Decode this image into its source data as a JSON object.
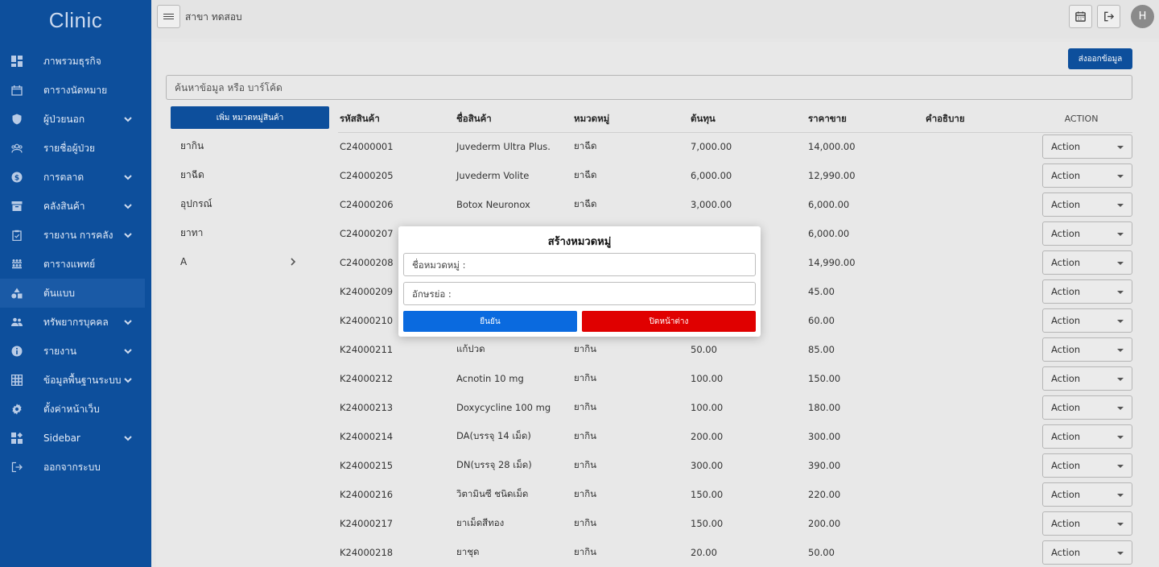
{
  "app": {
    "brand": "Clinic"
  },
  "sidebar": {
    "items": [
      {
        "label": "ภาพรวมธุรกิจ",
        "icon": "dashboard-icon",
        "has_submenu": false
      },
      {
        "label": "ตารางนัดหมาย",
        "icon": "calendar-icon",
        "has_submenu": false
      },
      {
        "label": "ผู้ป่วยนอก",
        "icon": "shield-icon",
        "has_submenu": true
      },
      {
        "label": "รายชื่อผู้ป่วย",
        "icon": "patients-icon",
        "has_submenu": false
      },
      {
        "label": "การตลาด",
        "icon": "dollar-icon",
        "has_submenu": true
      },
      {
        "label": "คลังสินค้า",
        "icon": "archive-icon",
        "has_submenu": true
      },
      {
        "label": "รายงาน การคลัง",
        "icon": "clipboard-icon",
        "has_submenu": true
      },
      {
        "label": "ตารางแพทย์",
        "icon": "doctors-icon",
        "has_submenu": false
      },
      {
        "label": "ต้นแบบ",
        "icon": "shapes-icon",
        "has_submenu": false,
        "active": true
      },
      {
        "label": "ทรัพยากรบุคคล",
        "icon": "people-icon",
        "has_submenu": true
      },
      {
        "label": "รายงาน",
        "icon": "info-icon",
        "has_submenu": true
      },
      {
        "label": "ข้อมูลพื้นฐานระบบ",
        "icon": "grid-icon",
        "has_submenu": true
      },
      {
        "label": "ตั้งค่าหน้าเว็บ",
        "icon": "gear-icon",
        "has_submenu": false
      },
      {
        "label": "Sidebar",
        "icon": "widgets-icon",
        "has_submenu": true
      },
      {
        "label": "ออกจากระบบ",
        "icon": "logout-icon",
        "has_submenu": false
      }
    ]
  },
  "topbar": {
    "branch": "สาขา ทดสอบ",
    "avatar_initial": "H"
  },
  "toolbar": {
    "export_label": "ส่งออกข้อมูล"
  },
  "search": {
    "placeholder": "ค้นหาข้อมูล หรือ บาร์โค้ด"
  },
  "categories": {
    "add_label": "เพิ่ม หมวดหมู่สินค้า",
    "items": [
      {
        "label": "ยากิน",
        "has_children": false
      },
      {
        "label": "ยาฉีด",
        "has_children": false
      },
      {
        "label": "อุปกรณ์",
        "has_children": false
      },
      {
        "label": "ยาทา",
        "has_children": false
      },
      {
        "label": "A",
        "has_children": true
      }
    ]
  },
  "table": {
    "headers": {
      "code": "รหัสสินค้า",
      "name": "ชื่อสินค้า",
      "category": "หมวดหมู่",
      "cost": "ต้นทุน",
      "price": "ราคาขาย",
      "description": "คำอธิบาย",
      "action": "ACTION"
    },
    "action_label": "Action",
    "rows": [
      {
        "code": "C24000001",
        "name": "Juvederm Ultra Plus.",
        "category": "ยาฉีด",
        "cost": "7,000.00",
        "price": "14,000.00",
        "description": ""
      },
      {
        "code": "C24000205",
        "name": "Juvederm Volite",
        "category": "ยาฉีด",
        "cost": "6,000.00",
        "price": "12,990.00",
        "description": ""
      },
      {
        "code": "C24000206",
        "name": "Botox Neuronox",
        "category": "ยาฉีด",
        "cost": "3,000.00",
        "price": "6,000.00",
        "description": ""
      },
      {
        "code": "C24000207",
        "name": "",
        "category": "",
        "cost": "",
        "price": "6,000.00",
        "description": ""
      },
      {
        "code": "C24000208",
        "name": "",
        "category": "",
        "cost": "",
        "price": "14,990.00",
        "description": ""
      },
      {
        "code": "K24000209",
        "name": "",
        "category": "",
        "cost": "",
        "price": "45.00",
        "description": ""
      },
      {
        "code": "K24000210",
        "name": "",
        "category": "",
        "cost": "",
        "price": "60.00",
        "description": ""
      },
      {
        "code": "K24000211",
        "name": "แก้ปวด",
        "category": "ยากิน",
        "cost": "50.00",
        "price": "85.00",
        "description": ""
      },
      {
        "code": "K24000212",
        "name": "Acnotin 10 mg",
        "category": "ยากิน",
        "cost": "100.00",
        "price": "150.00",
        "description": ""
      },
      {
        "code": "K24000213",
        "name": "Doxycycline 100 mg",
        "category": "ยากิน",
        "cost": "100.00",
        "price": "180.00",
        "description": ""
      },
      {
        "code": "K24000214",
        "name": "DA(บรรจุ 14 เม็ด)",
        "category": "ยากิน",
        "cost": "200.00",
        "price": "300.00",
        "description": ""
      },
      {
        "code": "K24000215",
        "name": "DN(บรรจุ 28 เม็ด)",
        "category": "ยากิน",
        "cost": "300.00",
        "price": "390.00",
        "description": ""
      },
      {
        "code": "K24000216",
        "name": "วิตามินซี ชนิดเม็ด",
        "category": "ยากิน",
        "cost": "150.00",
        "price": "220.00",
        "description": ""
      },
      {
        "code": "K24000217",
        "name": "ยาเม็ดสีทอง",
        "category": "ยากิน",
        "cost": "150.00",
        "price": "200.00",
        "description": ""
      },
      {
        "code": "K24000218",
        "name": "ยาชุด",
        "category": "ยากิน",
        "cost": "20.00",
        "price": "50.00",
        "description": ""
      }
    ]
  },
  "modal": {
    "title": "สร้างหมวดหมู่",
    "name_placeholder": "ชื่อหมวดหมู่ :",
    "abbr_placeholder": "อักษรย่อ :",
    "confirm_label": "ยืนยัน",
    "close_label": "ปิดหน้าต่าง"
  },
  "colors": {
    "sidebar": "#0d4f9c",
    "primary": "#0d4f9c",
    "confirm": "#0a6adf",
    "danger": "#e00000"
  }
}
